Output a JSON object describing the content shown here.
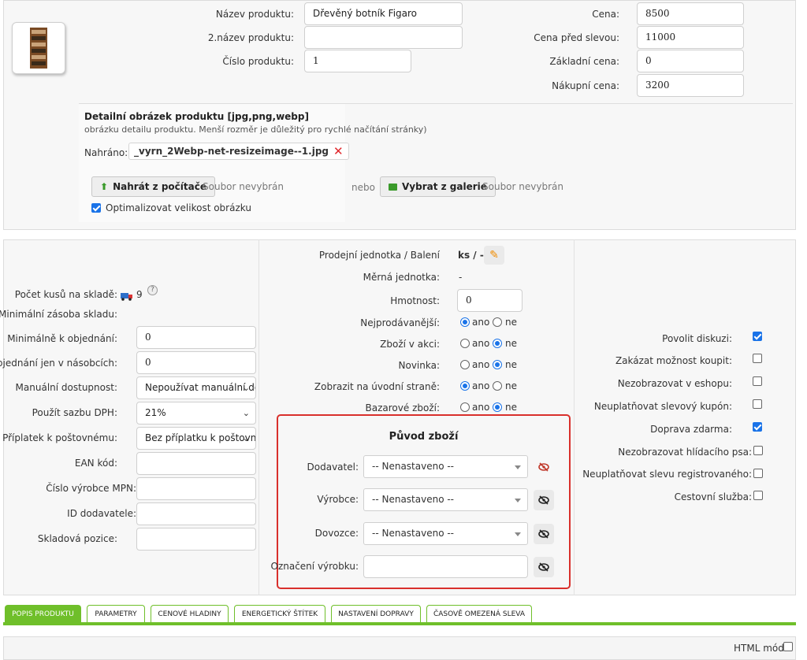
{
  "product": {
    "name_label": "Název produktu:",
    "name_value": "Dřevěný botník Figaro",
    "name2_label": "2.název produktu:",
    "name2_value": "",
    "number_label": "Číslo produktu:",
    "number_value": "1"
  },
  "prices": {
    "price_label": "Cena:",
    "price_value": "8500",
    "before_discount_label": "Cena před slevou:",
    "before_discount_value": "11000",
    "base_label": "Základní cena:",
    "base_value": "0",
    "purchase_label": "Nákupní cena:",
    "purchase_value": "3200"
  },
  "image_section": {
    "title": "Detailní obrázek produktu [jpg,png,webp]",
    "description": "obrázku detailu produktu. Menší rozměr je důležitý pro rychlé načítání stránky)",
    "uploaded_label": "Nahráno:",
    "uploaded_file": "_vyrn_2Webp-net-resizeimage--1.jpg",
    "upload_button": "Nahrát z počítače",
    "no_file_1": "Soubor nevybrán",
    "or_text": "nebo",
    "gallery_button": "Vybrat z galerie",
    "no_file_2": "Soubor nevybrán",
    "optimize_label": "Optimalizovat velikost obrázku",
    "optimize_checked": true
  },
  "stock": {
    "count_label": "Počet kusů na skladě:",
    "count_value": "9",
    "min_stock_label": "Minimální zásoba skladu:",
    "min_order_label": "Minimálně k objednání:",
    "min_order_value": "0",
    "multiples_label": "Objednání jen v násobcích:",
    "multiples_value": "0",
    "availability_label": "Manuální dostupnost:",
    "availability_value": "Nepoužívat manuální dostupnost",
    "vat_label": "Použít sazbu DPH:",
    "vat_value": "21%",
    "postage_label": "Příplatek k poštovnému:",
    "postage_value": "Bez příplatku k poštovnému",
    "ean_label": "EAN kód:",
    "ean_value": "",
    "mpn_label": "Číslo výrobce MPN:",
    "mpn_value": "",
    "supplier_id_label": "ID dodavatele:",
    "supplier_id_value": "",
    "position_label": "Skladová pozice:",
    "position_value": ""
  },
  "middle": {
    "unit_label": "Prodejní jednotka / Balení",
    "unit_value": "ks / -",
    "measure_label": "Měrná jednotka:",
    "measure_value": "-",
    "weight_label": "Hmotnost:",
    "weight_value": "0",
    "yes": "ano",
    "no": "ne",
    "bestseller_label": "Nejprodávanější:",
    "bestseller": "ano",
    "action_label": "Zboží v akci:",
    "action": "ne",
    "new_label": "Novinka:",
    "new": "ne",
    "homepage_label": "Zobrazit na úvodní straně:",
    "homepage": "ano",
    "bazaar_label": "Bazarové zboží:",
    "bazaar": "ne"
  },
  "origin": {
    "title": "Původ zboží",
    "supplier_label": "Dodavatel:",
    "supplier_value": "-- Nenastaveno --",
    "manufacturer_label": "Výrobce:",
    "manufacturer_value": "-- Nenastaveno --",
    "importer_label": "Dovozce:",
    "importer_value": "-- Nenastaveno --",
    "product_mark_label": "Označení výrobku:",
    "product_mark_value": ""
  },
  "options": [
    {
      "label": "Povolit diskuzi:",
      "checked": true
    },
    {
      "label": "Zakázat možnost koupit:",
      "checked": false
    },
    {
      "label": "Nezobrazovat v eshopu:",
      "checked": false
    },
    {
      "label": "Neuplatňovat slevový kupón:",
      "checked": false
    },
    {
      "label": "Doprava zdarma:",
      "checked": true
    },
    {
      "label": "Nezobrazovat hlídacího psa:",
      "checked": false
    },
    {
      "label": "Neuplatňovat slevu registrovaného:",
      "checked": false
    },
    {
      "label": "Cestovní služba:",
      "checked": false
    }
  ],
  "tabs": [
    {
      "label": "POPIS PRODUKTU",
      "active": true
    },
    {
      "label": "PARAMETRY",
      "active": false
    },
    {
      "label": "CENOVÉ HLADINY",
      "active": false
    },
    {
      "label": "ENERGETICKÝ ŠTÍTEK",
      "active": false
    },
    {
      "label": "NASTAVENÍ DOPRAVY",
      "active": false
    },
    {
      "label": "ČASOVĚ OMEZENÁ SLEVA",
      "active": false
    }
  ],
  "editor": {
    "html_mode_label": "HTML mód",
    "html_mode_checked": false
  },
  "colors": {
    "accent_green": "#6fbf2a",
    "highlight_red": "#d9302c",
    "checkbox_blue": "#1a73e8"
  }
}
